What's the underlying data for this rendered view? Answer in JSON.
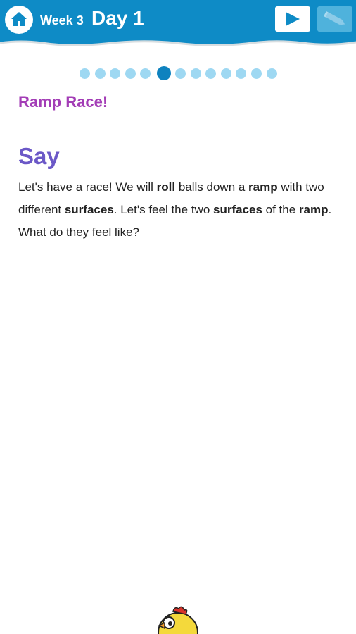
{
  "header": {
    "week_label": "Week 3",
    "day_label": "Day 1",
    "home_icon": "home-icon",
    "play_icon": "play-icon",
    "pencil_icon": "pencil-icon",
    "bar_color": "#0e8bc6"
  },
  "pagination": {
    "total": 13,
    "current": 6
  },
  "lesson": {
    "title": "Ramp Race!",
    "section_heading": "Say",
    "paragraph": [
      {
        "text": "Let's have a race! We will ",
        "bold": false
      },
      {
        "text": "roll",
        "bold": true
      },
      {
        "text": " balls down a ",
        "bold": false
      },
      {
        "text": "ramp",
        "bold": true
      },
      {
        "text": " with two different ",
        "bold": false
      },
      {
        "text": "surfaces",
        "bold": true
      },
      {
        "text": ". Let's feel the two ",
        "bold": false
      },
      {
        "text": "surfaces",
        "bold": true
      },
      {
        "text": " of the ",
        "bold": false
      },
      {
        "text": "ramp",
        "bold": true
      },
      {
        "text": ". What do they feel like?",
        "bold": false
      }
    ]
  },
  "mascot": {
    "icon": "chick-mascot-icon"
  }
}
